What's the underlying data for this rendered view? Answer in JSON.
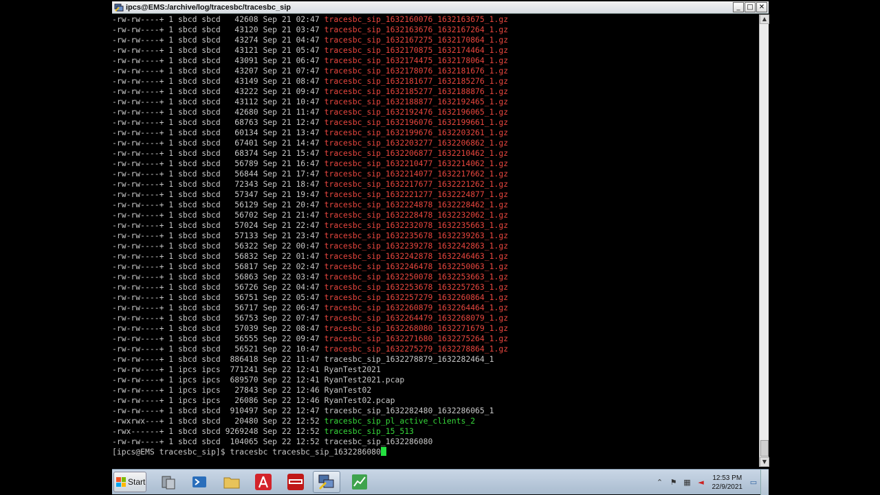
{
  "window": {
    "title": "ipcs@EMS:/archive/log/tracesbc/tracesbc_sip"
  },
  "controls": {
    "minimize": "_",
    "maximize": "□",
    "close": "✕"
  },
  "listing": [
    {
      "perms": "-rw-rw----+",
      "links": "1",
      "owner": "sbcd",
      "group": "sbcd",
      "size": "42608",
      "date": "Sep 21 02:47",
      "name": "tracesbc_sip_1632160076_1632163675_1.gz",
      "style": "gz"
    },
    {
      "perms": "-rw-rw----+",
      "links": "1",
      "owner": "sbcd",
      "group": "sbcd",
      "size": "43120",
      "date": "Sep 21 03:47",
      "name": "tracesbc_sip_1632163676_1632167264_1.gz",
      "style": "gz"
    },
    {
      "perms": "-rw-rw----+",
      "links": "1",
      "owner": "sbcd",
      "group": "sbcd",
      "size": "43274",
      "date": "Sep 21 04:47",
      "name": "tracesbc_sip_1632167275_1632170864_1.gz",
      "style": "gz"
    },
    {
      "perms": "-rw-rw----+",
      "links": "1",
      "owner": "sbcd",
      "group": "sbcd",
      "size": "43121",
      "date": "Sep 21 05:47",
      "name": "tracesbc_sip_1632170875_1632174464_1.gz",
      "style": "gz"
    },
    {
      "perms": "-rw-rw----+",
      "links": "1",
      "owner": "sbcd",
      "group": "sbcd",
      "size": "43091",
      "date": "Sep 21 06:47",
      "name": "tracesbc_sip_1632174475_1632178064_1.gz",
      "style": "gz"
    },
    {
      "perms": "-rw-rw----+",
      "links": "1",
      "owner": "sbcd",
      "group": "sbcd",
      "size": "43207",
      "date": "Sep 21 07:47",
      "name": "tracesbc_sip_1632178076_1632181676_1.gz",
      "style": "gz"
    },
    {
      "perms": "-rw-rw----+",
      "links": "1",
      "owner": "sbcd",
      "group": "sbcd",
      "size": "43149",
      "date": "Sep 21 08:47",
      "name": "tracesbc_sip_1632181677_1632185276_1.gz",
      "style": "gz"
    },
    {
      "perms": "-rw-rw----+",
      "links": "1",
      "owner": "sbcd",
      "group": "sbcd",
      "size": "43222",
      "date": "Sep 21 09:47",
      "name": "tracesbc_sip_1632185277_1632188876_1.gz",
      "style": "gz"
    },
    {
      "perms": "-rw-rw----+",
      "links": "1",
      "owner": "sbcd",
      "group": "sbcd",
      "size": "43112",
      "date": "Sep 21 10:47",
      "name": "tracesbc_sip_1632188877_1632192465_1.gz",
      "style": "gz"
    },
    {
      "perms": "-rw-rw----+",
      "links": "1",
      "owner": "sbcd",
      "group": "sbcd",
      "size": "42680",
      "date": "Sep 21 11:47",
      "name": "tracesbc_sip_1632192476_1632196065_1.gz",
      "style": "gz"
    },
    {
      "perms": "-rw-rw----+",
      "links": "1",
      "owner": "sbcd",
      "group": "sbcd",
      "size": "68763",
      "date": "Sep 21 12:47",
      "name": "tracesbc_sip_1632196076_1632199661_1.gz",
      "style": "gz"
    },
    {
      "perms": "-rw-rw----+",
      "links": "1",
      "owner": "sbcd",
      "group": "sbcd",
      "size": "60134",
      "date": "Sep 21 13:47",
      "name": "tracesbc_sip_1632199676_1632203261_1.gz",
      "style": "gz"
    },
    {
      "perms": "-rw-rw----+",
      "links": "1",
      "owner": "sbcd",
      "group": "sbcd",
      "size": "67401",
      "date": "Sep 21 14:47",
      "name": "tracesbc_sip_1632203277_1632206862_1.gz",
      "style": "gz"
    },
    {
      "perms": "-rw-rw----+",
      "links": "1",
      "owner": "sbcd",
      "group": "sbcd",
      "size": "68374",
      "date": "Sep 21 15:47",
      "name": "tracesbc_sip_1632206877_1632210462_1.gz",
      "style": "gz"
    },
    {
      "perms": "-rw-rw----+",
      "links": "1",
      "owner": "sbcd",
      "group": "sbcd",
      "size": "56789",
      "date": "Sep 21 16:47",
      "name": "tracesbc_sip_1632210477_1632214062_1.gz",
      "style": "gz"
    },
    {
      "perms": "-rw-rw----+",
      "links": "1",
      "owner": "sbcd",
      "group": "sbcd",
      "size": "56844",
      "date": "Sep 21 17:47",
      "name": "tracesbc_sip_1632214077_1632217662_1.gz",
      "style": "gz"
    },
    {
      "perms": "-rw-rw----+",
      "links": "1",
      "owner": "sbcd",
      "group": "sbcd",
      "size": "72343",
      "date": "Sep 21 18:47",
      "name": "tracesbc_sip_1632217677_1632221262_1.gz",
      "style": "gz"
    },
    {
      "perms": "-rw-rw----+",
      "links": "1",
      "owner": "sbcd",
      "group": "sbcd",
      "size": "57347",
      "date": "Sep 21 19:47",
      "name": "tracesbc_sip_1632221277_1632224877_1.gz",
      "style": "gz"
    },
    {
      "perms": "-rw-rw----+",
      "links": "1",
      "owner": "sbcd",
      "group": "sbcd",
      "size": "56129",
      "date": "Sep 21 20:47",
      "name": "tracesbc_sip_1632224878_1632228462_1.gz",
      "style": "gz"
    },
    {
      "perms": "-rw-rw----+",
      "links": "1",
      "owner": "sbcd",
      "group": "sbcd",
      "size": "56702",
      "date": "Sep 21 21:47",
      "name": "tracesbc_sip_1632228478_1632232062_1.gz",
      "style": "gz"
    },
    {
      "perms": "-rw-rw----+",
      "links": "1",
      "owner": "sbcd",
      "group": "sbcd",
      "size": "57024",
      "date": "Sep 21 22:47",
      "name": "tracesbc_sip_1632232078_1632235663_1.gz",
      "style": "gz"
    },
    {
      "perms": "-rw-rw----+",
      "links": "1",
      "owner": "sbcd",
      "group": "sbcd",
      "size": "57133",
      "date": "Sep 21 23:47",
      "name": "tracesbc_sip_1632235678_1632239263_1.gz",
      "style": "gz"
    },
    {
      "perms": "-rw-rw----+",
      "links": "1",
      "owner": "sbcd",
      "group": "sbcd",
      "size": "56322",
      "date": "Sep 22 00:47",
      "name": "tracesbc_sip_1632239278_1632242863_1.gz",
      "style": "gz"
    },
    {
      "perms": "-rw-rw----+",
      "links": "1",
      "owner": "sbcd",
      "group": "sbcd",
      "size": "56832",
      "date": "Sep 22 01:47",
      "name": "tracesbc_sip_1632242878_1632246463_1.gz",
      "style": "gz"
    },
    {
      "perms": "-rw-rw----+",
      "links": "1",
      "owner": "sbcd",
      "group": "sbcd",
      "size": "56817",
      "date": "Sep 22 02:47",
      "name": "tracesbc_sip_1632246478_1632250063_1.gz",
      "style": "gz"
    },
    {
      "perms": "-rw-rw----+",
      "links": "1",
      "owner": "sbcd",
      "group": "sbcd",
      "size": "56863",
      "date": "Sep 22 03:47",
      "name": "tracesbc_sip_1632250078_1632253663_1.gz",
      "style": "gz"
    },
    {
      "perms": "-rw-rw----+",
      "links": "1",
      "owner": "sbcd",
      "group": "sbcd",
      "size": "56726",
      "date": "Sep 22 04:47",
      "name": "tracesbc_sip_1632253678_1632257263_1.gz",
      "style": "gz"
    },
    {
      "perms": "-rw-rw----+",
      "links": "1",
      "owner": "sbcd",
      "group": "sbcd",
      "size": "56751",
      "date": "Sep 22 05:47",
      "name": "tracesbc_sip_1632257279_1632260864_1.gz",
      "style": "gz"
    },
    {
      "perms": "-rw-rw----+",
      "links": "1",
      "owner": "sbcd",
      "group": "sbcd",
      "size": "56717",
      "date": "Sep 22 06:47",
      "name": "tracesbc_sip_1632260879_1632264464_1.gz",
      "style": "gz"
    },
    {
      "perms": "-rw-rw----+",
      "links": "1",
      "owner": "sbcd",
      "group": "sbcd",
      "size": "56753",
      "date": "Sep 22 07:47",
      "name": "tracesbc_sip_1632264479_1632268079_1.gz",
      "style": "gz"
    },
    {
      "perms": "-rw-rw----+",
      "links": "1",
      "owner": "sbcd",
      "group": "sbcd",
      "size": "57039",
      "date": "Sep 22 08:47",
      "name": "tracesbc_sip_1632268080_1632271679_1.gz",
      "style": "gz"
    },
    {
      "perms": "-rw-rw----+",
      "links": "1",
      "owner": "sbcd",
      "group": "sbcd",
      "size": "56555",
      "date": "Sep 22 09:47",
      "name": "tracesbc_sip_1632271680_1632275264_1.gz",
      "style": "gz"
    },
    {
      "perms": "-rw-rw----+",
      "links": "1",
      "owner": "sbcd",
      "group": "sbcd",
      "size": "56521",
      "date": "Sep 22 10:47",
      "name": "tracesbc_sip_1632275279_1632278864_1.gz",
      "style": "gz"
    },
    {
      "perms": "-rw-rw----+",
      "links": "1",
      "owner": "sbcd",
      "group": "sbcd",
      "size": "886418",
      "date": "Sep 22 11:47",
      "name": "tracesbc_sip_1632278879_1632282464_1",
      "style": "plain"
    },
    {
      "perms": "-rw-rw----+",
      "links": "1",
      "owner": "ipcs",
      "group": "ipcs",
      "size": "771241",
      "date": "Sep 22 12:41",
      "name": "RyanTest2021",
      "style": "plain"
    },
    {
      "perms": "-rw-rw----+",
      "links": "1",
      "owner": "ipcs",
      "group": "ipcs",
      "size": "689570",
      "date": "Sep 22 12:41",
      "name": "RyanTest2021.pcap",
      "style": "plain"
    },
    {
      "perms": "-rw-rw----+",
      "links": "1",
      "owner": "ipcs",
      "group": "ipcs",
      "size": "27843",
      "date": "Sep 22 12:46",
      "name": "RyanTest02",
      "style": "plain"
    },
    {
      "perms": "-rw-rw----+",
      "links": "1",
      "owner": "ipcs",
      "group": "ipcs",
      "size": "26086",
      "date": "Sep 22 12:46",
      "name": "RyanTest02.pcap",
      "style": "plain"
    },
    {
      "perms": "-rw-rw----+",
      "links": "1",
      "owner": "sbcd",
      "group": "sbcd",
      "size": "910497",
      "date": "Sep 22 12:47",
      "name": "tracesbc_sip_1632282480_1632286065_1",
      "style": "plain"
    },
    {
      "perms": "-rwxrwx---+",
      "links": "1",
      "owner": "sbcd",
      "group": "sbcd",
      "size": "20480",
      "date": "Sep 22 12:52",
      "name": "tracesbc_sip_pl_active_clients_2",
      "style": "green"
    },
    {
      "perms": "-rwx------+",
      "links": "1",
      "owner": "sbcd",
      "group": "sbcd",
      "size": "9269248",
      "date": "Sep 22 12:52",
      "name": "tracesbc_sip_15_513",
      "style": "green"
    },
    {
      "perms": "-rw-rw----+",
      "links": "1",
      "owner": "sbcd",
      "group": "sbcd",
      "size": "104065",
      "date": "Sep 22 12:52",
      "name": "tracesbc_sip_1632286080",
      "style": "plain"
    }
  ],
  "prompt": {
    "text": "[ipcs@EMS tracesbc_sip]$ ",
    "command": "tracesbc tracesbc_sip_1632286080"
  },
  "taskbar": {
    "start_label": "Start",
    "clock_time": "12:53 PM",
    "clock_date": "22/9/2021",
    "tray_expand": "⌃"
  },
  "colors": {
    "gz": "#e8463e",
    "green": "#36d63a",
    "plain": "#c8c8c8",
    "cursor": "#24e040"
  }
}
